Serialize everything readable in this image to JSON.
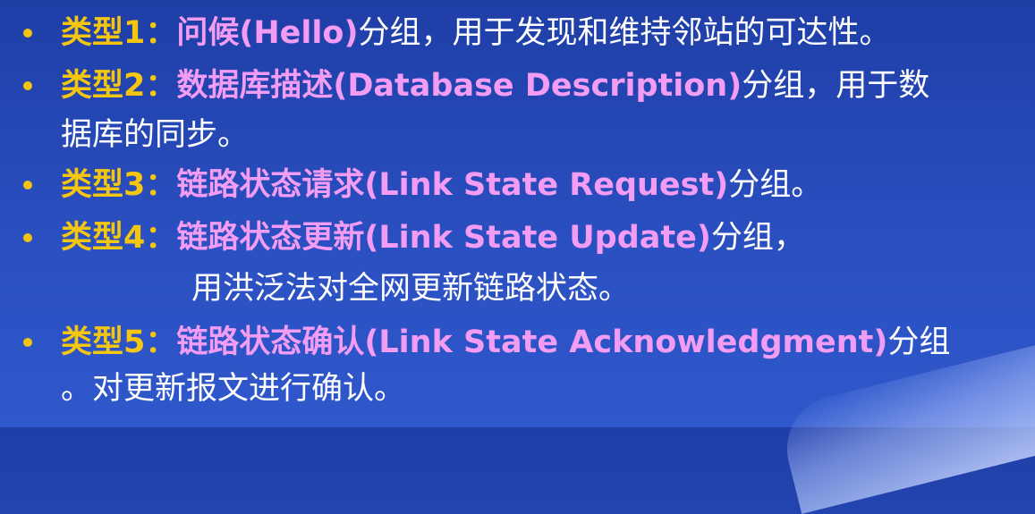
{
  "items": [
    {
      "type_label": "类型1",
      "colon": "：",
      "name": "问候(Hello)",
      "rest": "分组，用于发现和维持邻站的可达性。",
      "cont": ""
    },
    {
      "type_label": "类型2",
      "colon": "：",
      "name": "数据库描述(Database Description)",
      "rest": "分组，用于数",
      "cont": "据库的同步。"
    },
    {
      "type_label": "类型3",
      "colon": "：",
      "name": "链路状态请求(Link State Request)",
      "rest": "分组。",
      "cont": ""
    },
    {
      "type_label": "类型4",
      "colon": "：",
      "name": "链路状态更新(Link State Update)",
      "rest": "分组，",
      "cont": "用洪泛法对全网更新链路状态。"
    },
    {
      "type_label": "类型5",
      "colon": "：",
      "name": "链路状态确认(Link State Acknowledgment)",
      "rest": "分组",
      "cont": "。对更新报文进行确认。"
    }
  ],
  "colors": {
    "background": "#2a4fc0",
    "bullet": "#f2c40f",
    "type_label": "#f5c60f",
    "name": "#f39cf4",
    "body_text": "#ffffff"
  }
}
